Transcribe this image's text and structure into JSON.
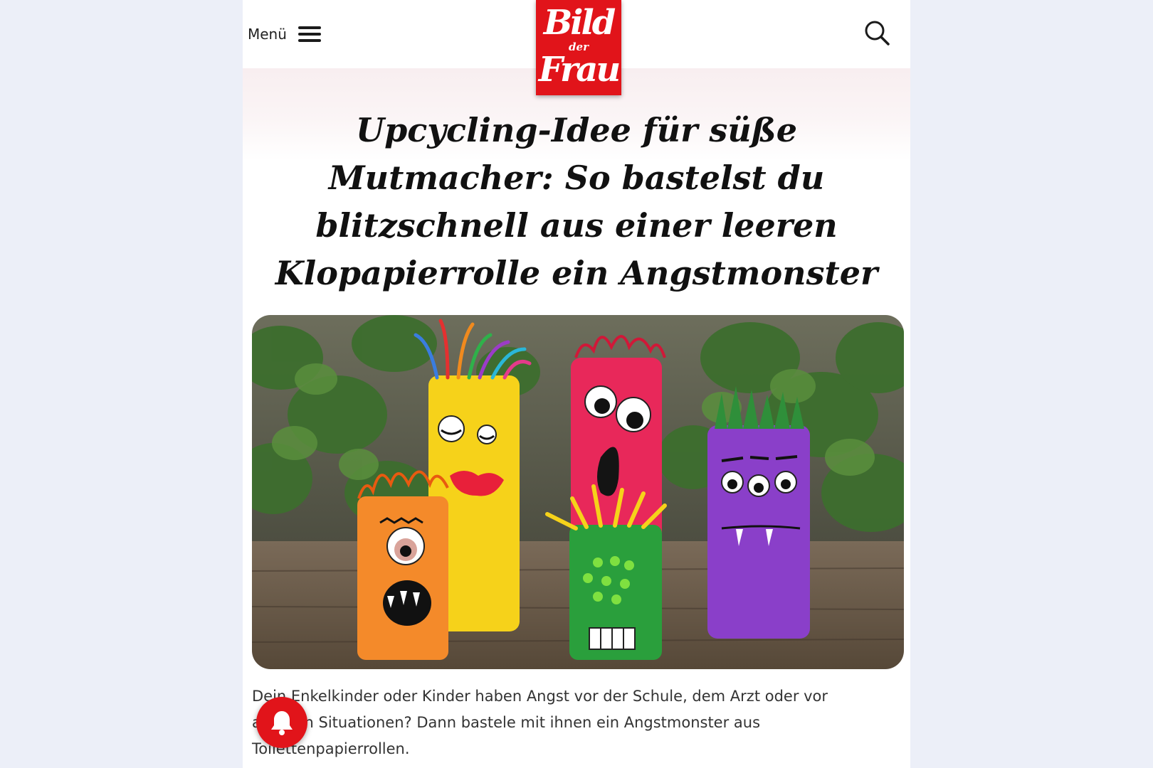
{
  "header": {
    "menu_label": "Menü",
    "logo_line1": "Bild",
    "logo_line2": "der",
    "logo_line3": "Frau"
  },
  "article": {
    "title": "Upcycling-Idee für süße Mutmacher: So bastelst du blitzschnell aus einer leeren Klopapierrolle ein Angstmonster",
    "intro": "Dein Enkelkinder oder Kinder haben Angst vor der Schule, dem Arzt oder vor anderen Situationen? Dann bastele mit ihnen ein Angstmonster aus Toilettenpapierrollen."
  },
  "icons": {
    "menu": "hamburger-icon",
    "search": "search-icon",
    "notification": "bell-icon"
  },
  "colors": {
    "brand_red": "#e1141a",
    "page_background": "#eceff8",
    "text": "#111111"
  }
}
